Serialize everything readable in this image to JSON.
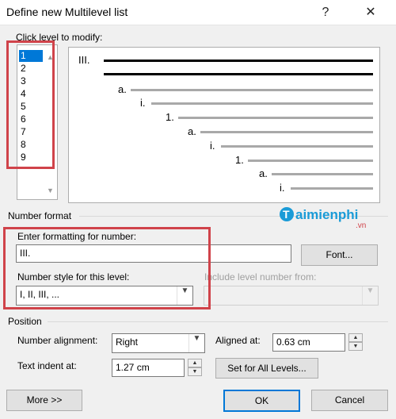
{
  "window": {
    "title": "Define new Multilevel list",
    "help_glyph": "?",
    "close_glyph": "✕"
  },
  "click_level": {
    "label": "Click level to modify:",
    "levels": [
      "1",
      "2",
      "3",
      "4",
      "5",
      "6",
      "7",
      "8",
      "9"
    ],
    "selected": "1"
  },
  "preview": {
    "labels": [
      "III.",
      "a.",
      "i.",
      "1.",
      "a.",
      "i.",
      "1.",
      "a.",
      "i."
    ]
  },
  "number_format": {
    "group_label": "Number format",
    "enter_label": "Enter formatting for number:",
    "format_value": "III.",
    "font_button": "Font...",
    "style_label": "Number style for this level:",
    "style_value": "I, II, III, ...",
    "include_label": "Include level number from:",
    "include_value": ""
  },
  "position": {
    "group_label": "Position",
    "alignment_label": "Number alignment:",
    "alignment_value": "Right",
    "aligned_at_label": "Aligned at:",
    "aligned_at_value": "0.63 cm",
    "indent_label": "Text indent at:",
    "indent_value": "1.27 cm",
    "set_all_button": "Set for All Levels..."
  },
  "footer": {
    "more_button": "More >>",
    "ok_button": "OK",
    "cancel_button": "Cancel"
  },
  "watermark": {
    "brand": "aimienphi",
    "initial": "T",
    "suffix": ".vn"
  },
  "colors": {
    "highlight_red": "#d0434a",
    "selection_blue": "#0078d7"
  }
}
